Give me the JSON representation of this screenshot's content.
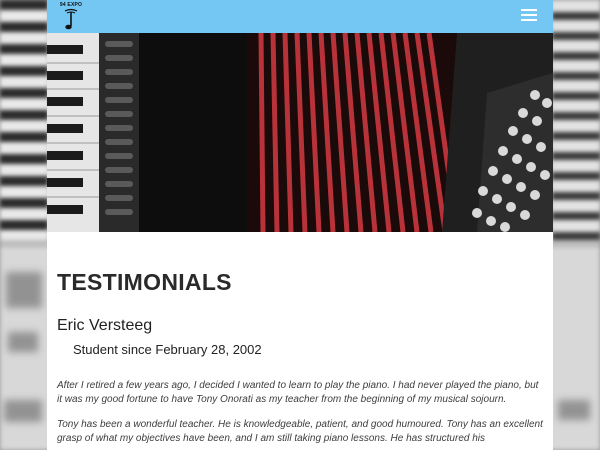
{
  "navbar": {
    "logo_text": "94 EXPO",
    "menu_icon": "hamburger-menu-icon",
    "background_color": "#74c7f2"
  },
  "hero": {
    "subject": "accordion-keys-and-bellows"
  },
  "main": {
    "heading": "TESTIMONIALS",
    "testimonial": {
      "name": "Eric Versteeg",
      "since": "Student since February 28, 2002",
      "paragraphs": [
        "After I retired a few years ago, I decided I wanted to learn to play the piano. I had never played the piano, but it was my good fortune to have Tony Onorati as my teacher from the beginning of my musical sojourn.",
        "Tony has been a wonderful teacher. He is knowledgeable, patient, and good humoured. Tony has an excellent grasp of what my objectives have been, and I am still taking piano lessons. He has structured his"
      ]
    }
  }
}
